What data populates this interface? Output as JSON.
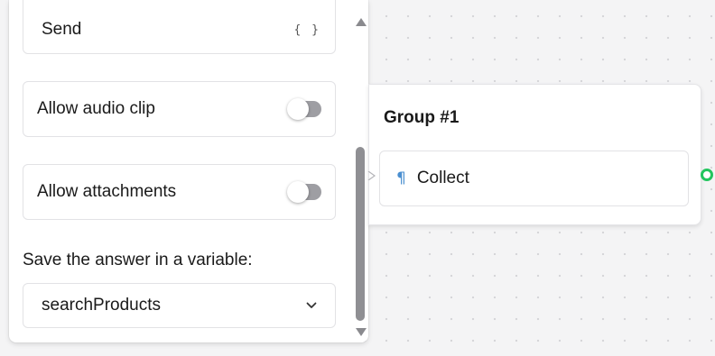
{
  "settings_panel": {
    "send_label": "Send",
    "send_icon": "{ }",
    "allow_audio_clip": {
      "label": "Allow audio clip",
      "enabled": false
    },
    "allow_attachments": {
      "label": "Allow attachments",
      "enabled": false
    },
    "save_variable_label": "Save the answer in a variable:",
    "variable_value": "searchProducts",
    "variable_chevron": "⌄"
  },
  "canvas": {
    "group": {
      "title": "Group #1",
      "blocks": [
        {
          "icon": "¶",
          "label": "Collect"
        }
      ]
    }
  },
  "colors": {
    "accent_green": "#22c55e",
    "block_icon_blue": "#4a8fd0",
    "switch_off": "#9e9ea3"
  }
}
